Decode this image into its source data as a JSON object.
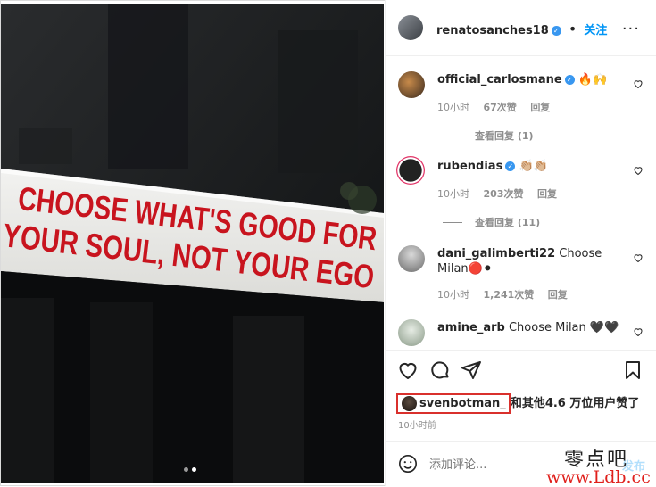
{
  "post": {
    "image_text_line1": "CHOOSE WHAT'S GOOD FOR",
    "image_text_line2": "YOUR SOUL, NOT YOUR EGO",
    "carousel_dots": 2,
    "carousel_active": 2
  },
  "header": {
    "username": "renatosanches18",
    "follow_label": "关注",
    "more_label": "···"
  },
  "comments": [
    {
      "user": "official_carlosmane",
      "text": "🔥🙌",
      "time": "10小时",
      "likes": "67次赞",
      "reply": "回复",
      "view_replies": "查看回复 (1)",
      "verified": true
    },
    {
      "user": "rubendias",
      "text": "👏🏼👏🏼",
      "time": "10小时",
      "likes": "203次赞",
      "reply": "回复",
      "view_replies": "查看回复 (11)",
      "verified": true
    },
    {
      "user": "dani_galimberti22",
      "text": "Choose Milan🔴⚫",
      "time": "10小时",
      "likes": "1,241次赞",
      "reply": "回复",
      "view_replies": "",
      "verified": false
    },
    {
      "user": "amine_arb",
      "text": "Choose Milan 🖤🖤",
      "time": "",
      "likes": "",
      "reply": "",
      "view_replies": "",
      "verified": false
    }
  ],
  "likes_line": {
    "user": "svenbotman_",
    "rest": "和其他4.6 万位用户赞了"
  },
  "post_time": "10小时前",
  "add_comment": {
    "placeholder": "添加评论...",
    "post_label": "发布"
  },
  "watermark": {
    "title": "零点吧",
    "url": "www.Ldb.cc"
  },
  "colors": {
    "accent": "#0095f6",
    "verified": "#3897f0",
    "highlight_box": "#d9302c",
    "sign_text": "#c8141e"
  }
}
